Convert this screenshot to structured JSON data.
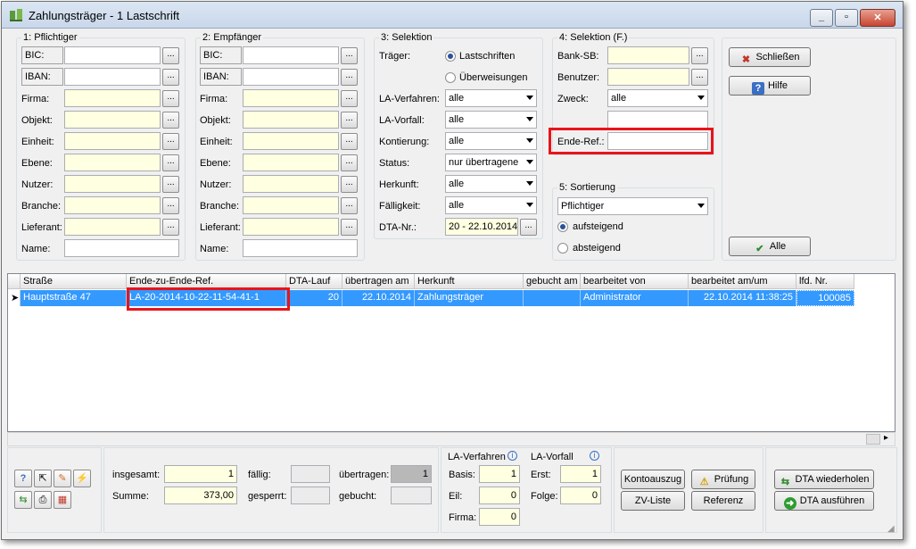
{
  "window": {
    "title": "Zahlungsträger - 1 Lastschrift"
  },
  "group1": {
    "title": "1: Pflichtiger",
    "fields": [
      {
        "label": "BIC:",
        "value": ""
      },
      {
        "label": "IBAN:",
        "value": ""
      },
      {
        "label": "Firma:",
        "value": ""
      },
      {
        "label": "Objekt:",
        "value": ""
      },
      {
        "label": "Einheit:",
        "value": ""
      },
      {
        "label": "Ebene:",
        "value": ""
      },
      {
        "label": "Nutzer:",
        "value": ""
      },
      {
        "label": "Branche:",
        "value": ""
      },
      {
        "label": "Lieferant:",
        "value": ""
      },
      {
        "label": "Name:",
        "value": ""
      }
    ]
  },
  "group2": {
    "title": "2: Empfänger",
    "fields": [
      {
        "label": "BIC:",
        "value": ""
      },
      {
        "label": "IBAN:",
        "value": ""
      },
      {
        "label": "Firma:",
        "value": ""
      },
      {
        "label": "Objekt:",
        "value": ""
      },
      {
        "label": "Einheit:",
        "value": ""
      },
      {
        "label": "Ebene:",
        "value": ""
      },
      {
        "label": "Nutzer:",
        "value": ""
      },
      {
        "label": "Branche:",
        "value": ""
      },
      {
        "label": "Lieferant:",
        "value": ""
      },
      {
        "label": "Name:",
        "value": ""
      }
    ]
  },
  "group3": {
    "title": "3: Selektion",
    "traeger_label": "Träger:",
    "radio_lastschriften": "Lastschriften",
    "radio_ueberweisungen": "Überweisungen",
    "selected_traeger": "Lastschriften",
    "la_verfahren_label": "LA-Verfahren:",
    "la_verfahren_value": "alle",
    "la_vorfall_label": "LA-Vorfall:",
    "la_vorfall_value": "alle",
    "kontierung_label": "Kontierung:",
    "kontierung_value": "alle",
    "status_label": "Status:",
    "status_value": "nur übertragene",
    "herkunft_label": "Herkunft:",
    "herkunft_value": "alle",
    "faelligkeit_label": "Fälligkeit:",
    "faelligkeit_value": "alle",
    "dta_nr_label": "DTA-Nr.:",
    "dta_nr_value": "20 - 22.10.2014"
  },
  "group4": {
    "title": "4: Selektion (F.)",
    "bank_sb_label": "Bank-SB:",
    "bank_sb_value": "",
    "benutzer_label": "Benutzer:",
    "benutzer_value": "",
    "zweck_label": "Zweck:",
    "zweck_value": "alle",
    "ende_ref_label": "Ende-Ref.:",
    "ende_ref_value": ""
  },
  "group5": {
    "title": "5: Sortierung",
    "sort_value": "Pflichtiger",
    "asc_label": "aufsteigend",
    "desc_label": "absteigend",
    "selected": "aufsteigend"
  },
  "side_buttons": {
    "close": "Schließen",
    "help": "Hilfe",
    "all": "Alle"
  },
  "grid": {
    "columns": [
      "Straße",
      "Ende-zu-Ende-Ref.",
      "DTA-Lauf",
      "übertragen am",
      "Herkunft",
      "gebucht am",
      "bearbeitet von",
      "bearbeitet am/um",
      "lfd. Nr."
    ],
    "rows": [
      [
        "Hauptstraße 47",
        "LA-20-2014-10-22-11-54-41-1",
        "20",
        "22.10.2014",
        "Zahlungsträger",
        "",
        "Administrator",
        "22.10.2014 11:38:25",
        "100085"
      ]
    ]
  },
  "totals": {
    "insgesamt_label": "insgesamt:",
    "insgesamt_value": "1",
    "summe_label": "Summe:",
    "summe_value": "373,00",
    "faellig_label": "fällig:",
    "faellig_value": "",
    "gesperrt_label": "gesperrt:",
    "gesperrt_value": "",
    "uebertragen_label": "übertragen:",
    "uebertragen_value": "1",
    "gebucht_label": "gebucht:",
    "gebucht_value": ""
  },
  "la_stats": {
    "verfahren_title": "LA-Verfahren",
    "vorfall_title": "LA-Vorfall",
    "basis_label": "Basis:",
    "basis_value": "1",
    "eil_label": "Eil:",
    "eil_value": "0",
    "firma_label": "Firma:",
    "firma_value": "0",
    "erst_label": "Erst:",
    "erst_value": "1",
    "folge_label": "Folge:",
    "folge_value": "0"
  },
  "action_buttons": {
    "kontoauszug": "Kontoauszug",
    "pruefung": "Prüfung",
    "zv_liste": "ZV-Liste",
    "referenz": "Referenz",
    "dta_wiederholen": "DTA wiederholen",
    "dta_ausfuehren": "DTA ausführen"
  }
}
